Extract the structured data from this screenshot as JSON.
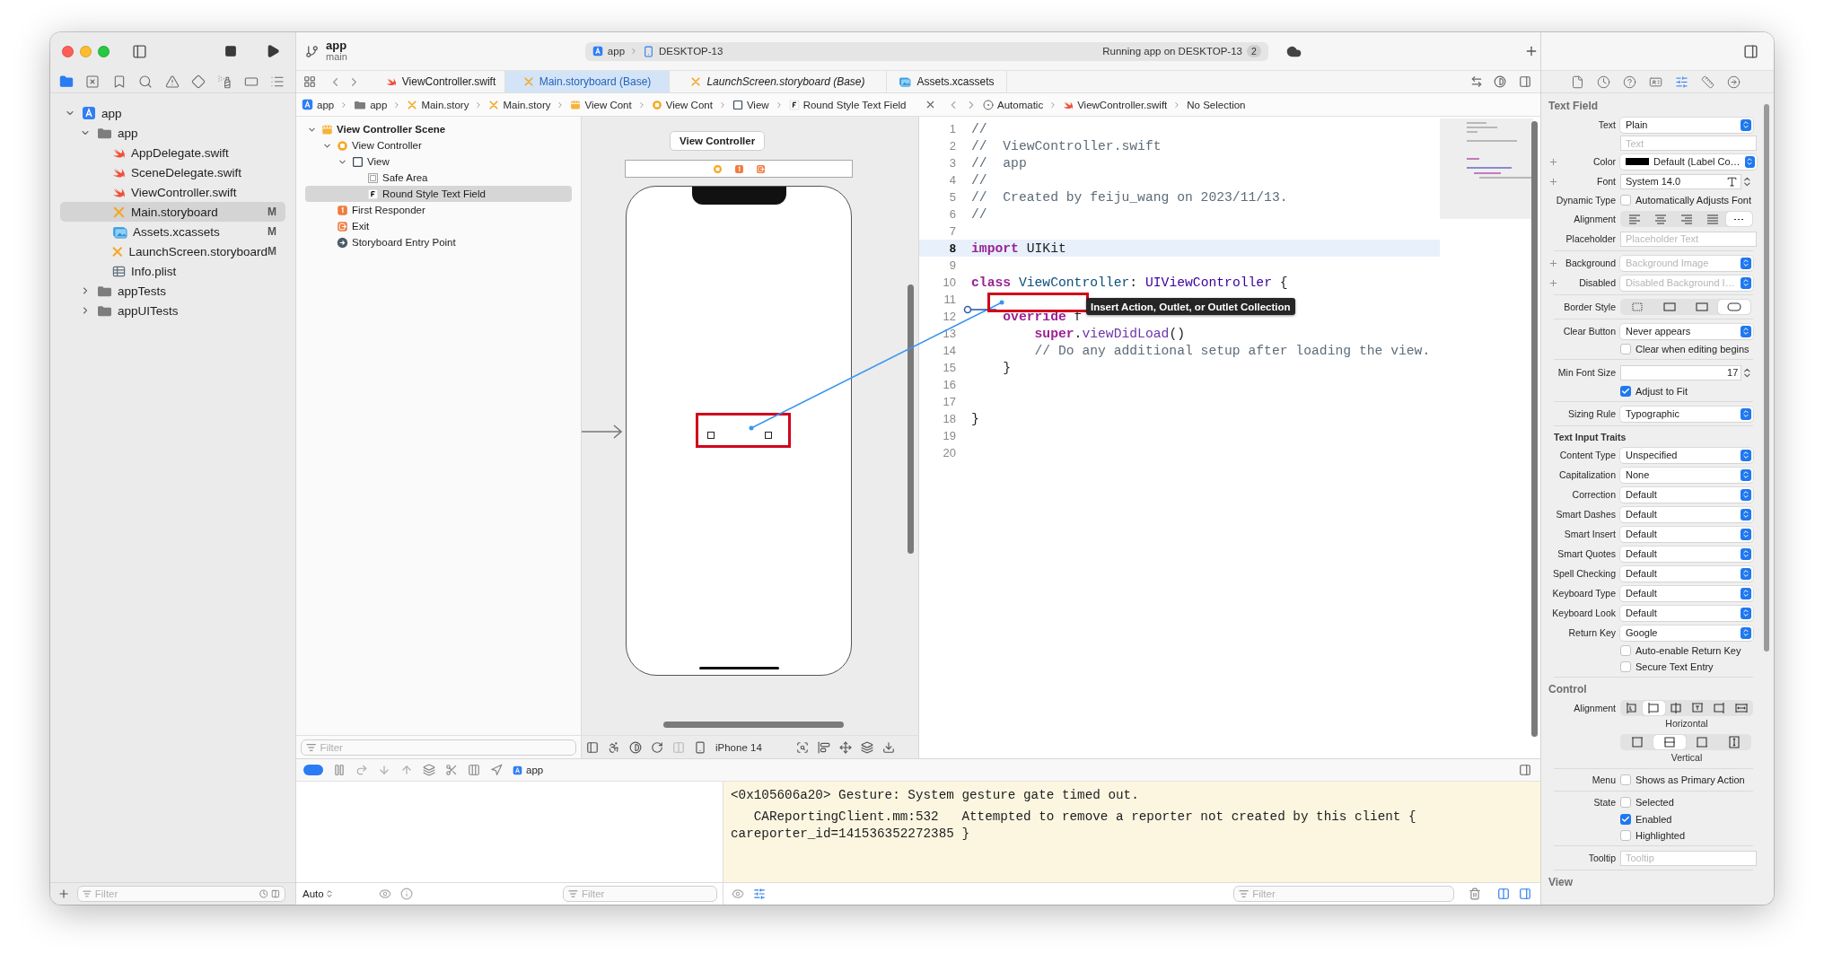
{
  "toolbar": {
    "scheme": "app",
    "branch": "main",
    "activity": {
      "target": "app",
      "device": "DESKTOP-13",
      "status": "Running app on DESKTOP-13",
      "count": "2"
    }
  },
  "navigator": {
    "tabs": [
      {
        "kind": "folder",
        "selected": true
      },
      {
        "kind": "source-control",
        "selected": false
      },
      {
        "kind": "bookmark",
        "selected": false
      },
      {
        "kind": "search",
        "selected": false
      },
      {
        "kind": "issues",
        "selected": false
      },
      {
        "kind": "tests",
        "selected": false
      },
      {
        "kind": "debug",
        "selected": false
      },
      {
        "kind": "breakpoints",
        "selected": false
      },
      {
        "kind": "reports",
        "selected": false
      }
    ],
    "tree": [
      {
        "label": "app",
        "kind": "project",
        "expanded": true,
        "selected": false,
        "children": [
          {
            "label": "app",
            "kind": "folder",
            "expanded": true,
            "selected": false,
            "children": [
              {
                "label": "AppDelegate.swift",
                "kind": "swift",
                "selected": false
              },
              {
                "label": "SceneDelegate.swift",
                "kind": "swift",
                "selected": false
              },
              {
                "label": "ViewController.swift",
                "kind": "swift",
                "selected": false
              },
              {
                "label": "Main.storyboard",
                "kind": "storyboard",
                "selected": true,
                "status": "M"
              },
              {
                "label": "Assets.xcassets",
                "kind": "assets",
                "selected": false,
                "status": "M"
              },
              {
                "label": "LaunchScreen.storyboard",
                "kind": "storyboard",
                "selected": false,
                "status": "M"
              },
              {
                "label": "Info.plist",
                "kind": "plist",
                "selected": false
              }
            ]
          },
          {
            "label": "appTests",
            "kind": "folder",
            "expanded": false,
            "selected": false
          },
          {
            "label": "appUITests",
            "kind": "folder",
            "expanded": false,
            "selected": false
          }
        ]
      }
    ],
    "filter": {
      "placeholder": "Filter"
    }
  },
  "tabs": [
    {
      "label": "ViewController.swift",
      "kind": "swift",
      "selected": false,
      "preview": false
    },
    {
      "label": "Main.storyboard (Base)",
      "kind": "storyboard",
      "selected": true,
      "preview": false
    },
    {
      "label": "LaunchScreen.storyboard (Base)",
      "kind": "storyboard",
      "selected": false,
      "preview": true
    },
    {
      "label": "Assets.xcassets",
      "kind": "assets",
      "selected": false,
      "preview": false
    }
  ],
  "jump_bar": [
    {
      "label": "app",
      "kind": "project"
    },
    {
      "label": "app",
      "kind": "folder"
    },
    {
      "label": "Main.story",
      "kind": "storyboard"
    },
    {
      "label": "Main.story",
      "kind": "storyboard"
    },
    {
      "label": "View Cont",
      "kind": "scene"
    },
    {
      "label": "View Cont",
      "kind": "vc"
    },
    {
      "label": "View",
      "kind": "view"
    },
    {
      "label": "Round Style Text Field",
      "kind": "textfield"
    }
  ],
  "outline": {
    "tree": [
      {
        "label": "View Controller Scene",
        "kind": "scene",
        "expanded": true,
        "selected": false,
        "children": [
          {
            "label": "View Controller",
            "kind": "vc",
            "expanded": true,
            "selected": false,
            "children": [
              {
                "label": "View",
                "kind": "view",
                "expanded": true,
                "selected": false,
                "children": [
                  {
                    "label": "Safe Area",
                    "kind": "safearea",
                    "selected": false
                  },
                  {
                    "label": "Round Style Text Field",
                    "kind": "textfield",
                    "selected": true
                  }
                ]
              }
            ]
          },
          {
            "label": "First Responder",
            "kind": "responder",
            "selected": false
          },
          {
            "label": "Exit",
            "kind": "exit",
            "selected": false
          },
          {
            "label": "Storyboard Entry Point",
            "kind": "entry",
            "selected": false
          }
        ]
      }
    ],
    "filter": {
      "placeholder": "Filter"
    }
  },
  "canvas": {
    "scene_title": "View Controller",
    "device": "iPhone 14"
  },
  "assistant": {
    "mode": "Automatic",
    "file": "ViewController.swift",
    "selection": "No Selection",
    "lines": [
      {
        "number": "1",
        "current": false,
        "tokens": [
          {
            "text": "//",
            "kind": "comment"
          }
        ]
      },
      {
        "number": "2",
        "current": false,
        "tokens": [
          {
            "text": "//  ViewController.swift",
            "kind": "comment"
          }
        ]
      },
      {
        "number": "3",
        "current": false,
        "tokens": [
          {
            "text": "//  app",
            "kind": "comment"
          }
        ]
      },
      {
        "number": "4",
        "current": false,
        "tokens": [
          {
            "text": "//",
            "kind": "comment"
          }
        ]
      },
      {
        "number": "5",
        "current": false,
        "tokens": [
          {
            "text": "//  Created by feiju_wang on 2023/11/13.",
            "kind": "comment"
          }
        ]
      },
      {
        "number": "6",
        "current": false,
        "tokens": [
          {
            "text": "//",
            "kind": "comment"
          }
        ]
      },
      {
        "number": "7",
        "current": false
      },
      {
        "number": "8",
        "current": true,
        "tokens": [
          {
            "text": "import",
            "kind": "keyword"
          },
          {
            "text": " UIKit",
            "kind": "plain"
          }
        ]
      },
      {
        "number": "9",
        "current": false
      },
      {
        "number": "10",
        "current": false,
        "tokens": [
          {
            "text": "class",
            "kind": "keyword"
          },
          {
            "text": " ViewController",
            "kind": "declaration"
          },
          {
            "text": ": ",
            "kind": "plain"
          },
          {
            "text": "UIViewController",
            "kind": "type"
          },
          {
            "text": " {",
            "kind": "plain"
          }
        ]
      },
      {
        "number": "11",
        "current": false
      },
      {
        "number": "12",
        "current": false,
        "tokens": [
          {
            "text": "    override",
            "kind": "keyword"
          },
          {
            "text": " f",
            "kind": "plain"
          }
        ]
      },
      {
        "number": "13",
        "current": false,
        "tokens": [
          {
            "text": "        super",
            "kind": "keyword"
          },
          {
            "text": ".",
            "kind": "plain"
          },
          {
            "text": "viewDidLoad",
            "kind": "method"
          },
          {
            "text": "()",
            "kind": "plain"
          }
        ]
      },
      {
        "number": "14",
        "current": false,
        "tokens": [
          {
            "text": "        // Do any additional setup after loading the view.",
            "kind": "comment"
          }
        ]
      },
      {
        "number": "15",
        "current": false,
        "tokens": [
          {
            "text": "    }",
            "kind": "plain"
          }
        ]
      },
      {
        "number": "16",
        "current": false
      },
      {
        "number": "17",
        "current": false
      },
      {
        "number": "18",
        "current": false,
        "tokens": [
          {
            "text": "}",
            "kind": "plain"
          }
        ]
      },
      {
        "number": "19",
        "current": false
      },
      {
        "number": "20",
        "current": false
      }
    ]
  },
  "connection": {
    "tooltip": "Insert Action, Outlet, or Outlet Collection"
  },
  "debug": {
    "target": "app",
    "variables_mode": "Auto",
    "variables_filter": {
      "placeholder": "Filter"
    },
    "console_filter": {
      "placeholder": "Filter"
    },
    "console_lines": [
      "<0x105606a20> Gesture: System gesture gate timed out.",
      "   CAReportingClient.mm:532   Attempted to remove a reporter not created by this client { careporter_id=141536352272385 }"
    ]
  },
  "inspector": {
    "tabs": [
      {
        "kind": "file",
        "selected": false
      },
      {
        "kind": "history",
        "selected": false
      },
      {
        "kind": "help",
        "selected": false
      },
      {
        "kind": "identity",
        "selected": false
      },
      {
        "kind": "attributes",
        "selected": true
      },
      {
        "kind": "size",
        "selected": false
      },
      {
        "kind": "connections",
        "selected": false
      }
    ],
    "sections": [
      {
        "title": "Text Field",
        "rows": [
          {
            "kind": "popup",
            "label": "Text",
            "value": "Plain"
          },
          {
            "kind": "field",
            "placeholder": "Text"
          },
          {
            "kind": "color",
            "label": "Color",
            "value": "Default (Label Co…",
            "add": true
          },
          {
            "kind": "font",
            "label": "Font",
            "value": "System 14.0",
            "add": true
          },
          {
            "kind": "checkbox",
            "label": "Dynamic Type",
            "text": "Automatically Adjusts Font",
            "checked": false
          },
          {
            "kind": "segments",
            "label": "Alignment",
            "segments": [
              {
                "kind": "align-left",
                "selected": false
              },
              {
                "kind": "align-center",
                "selected": false
              },
              {
                "kind": "align-right",
                "selected": false
              },
              {
                "kind": "justify",
                "selected": false
              },
              {
                "kind": "natural",
                "selected": true
              }
            ]
          },
          {
            "kind": "field",
            "label": "Placeholder",
            "placeholder": "Placeholder Text"
          },
          {
            "kind": "divider"
          },
          {
            "kind": "popup",
            "label": "Background",
            "placeholder": "Background Image",
            "add": true
          },
          {
            "kind": "popup",
            "label": "Disabled",
            "placeholder": "Disabled Background I…",
            "add": true
          },
          {
            "kind": "divider"
          },
          {
            "kind": "segments",
            "label": "Border Style",
            "segments": [
              {
                "kind": "dotted",
                "selected": false
              },
              {
                "kind": "line",
                "selected": false
              },
              {
                "kind": "bezel",
                "selected": false
              },
              {
                "kind": "rounded",
                "selected": true
              }
            ]
          },
          {
            "kind": "divider"
          },
          {
            "kind": "popup",
            "label": "Clear Button",
            "value": "Never appears"
          },
          {
            "kind": "checkbox",
            "text": "Clear when editing begins",
            "checked": false
          },
          {
            "kind": "divider"
          },
          {
            "kind": "stepper",
            "label": "Min Font Size",
            "value": "17"
          },
          {
            "kind": "checkbox",
            "text": "Adjust to Fit",
            "checked": true
          },
          {
            "kind": "divider"
          },
          {
            "kind": "popup",
            "label": "Sizing Rule",
            "value": "Typographic"
          },
          {
            "kind": "divider"
          },
          {
            "kind": "subheading",
            "text": "Text Input Traits"
          },
          {
            "kind": "popup",
            "label": "Content Type",
            "value": "Unspecified"
          },
          {
            "kind": "popup",
            "label": "Capitalization",
            "value": "None"
          },
          {
            "kind": "popup",
            "label": "Correction",
            "value": "Default"
          },
          {
            "kind": "popup",
            "label": "Smart Dashes",
            "value": "Default"
          },
          {
            "kind": "popup",
            "label": "Smart Insert",
            "value": "Default"
          },
          {
            "kind": "popup",
            "label": "Smart Quotes",
            "value": "Default"
          },
          {
            "kind": "popup",
            "label": "Spell Checking",
            "value": "Default"
          },
          {
            "kind": "popup",
            "label": "Keyboard Type",
            "value": "Default"
          },
          {
            "kind": "popup",
            "label": "Keyboard Look",
            "value": "Default"
          },
          {
            "kind": "popup",
            "label": "Return Key",
            "value": "Google"
          },
          {
            "kind": "checkbox",
            "text": "Auto-enable Return Key",
            "checked": false
          },
          {
            "kind": "checkbox",
            "text": "Secure Text Entry",
            "checked": false
          },
          {
            "kind": "divider"
          }
        ]
      },
      {
        "title": "Control",
        "rows": [
          {
            "kind": "segments",
            "label": "Alignment",
            "caption": "Horizontal",
            "segments": [
              {
                "kind": "edge-left",
                "selected": false
              },
              {
                "kind": "box-left",
                "selected": true
              },
              {
                "kind": "center-h",
                "selected": false
              },
              {
                "kind": "box-top",
                "selected": false
              },
              {
                "kind": "box-right",
                "selected": false
              },
              {
                "kind": "fill-h",
                "selected": false
              }
            ]
          },
          {
            "kind": "segments",
            "caption": "Vertical",
            "segments": [
              {
                "kind": "top",
                "selected": false
              },
              {
                "kind": "center-v",
                "selected": true
              },
              {
                "kind": "bottom",
                "selected": false
              },
              {
                "kind": "fill-v",
                "selected": false
              }
            ]
          },
          {
            "kind": "divider"
          },
          {
            "kind": "checkbox",
            "label": "Menu",
            "text": "Shows as Primary Action",
            "checked": false
          },
          {
            "kind": "divider"
          },
          {
            "kind": "checkbox",
            "label": "State",
            "text": "Selected",
            "checked": false
          },
          {
            "kind": "checkbox",
            "text": "Enabled",
            "checked": true
          },
          {
            "kind": "checkbox",
            "text": "Highlighted",
            "checked": false
          },
          {
            "kind": "divider"
          },
          {
            "kind": "field",
            "label": "Tooltip",
            "placeholder": "Tooltip"
          },
          {
            "kind": "divider"
          }
        ]
      },
      {
        "title": "View"
      }
    ]
  }
}
